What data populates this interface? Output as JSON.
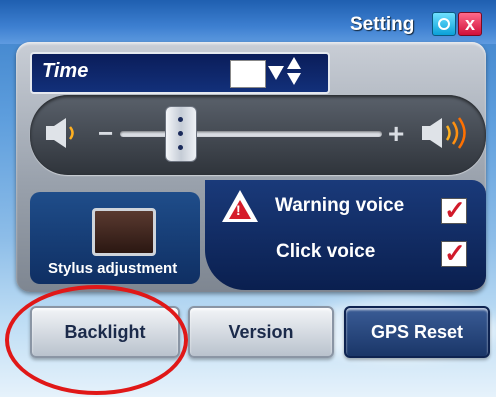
{
  "window": {
    "title": "Setting",
    "ok_icon": "ok-icon",
    "close_icon": "close-icon",
    "close_glyph": "x"
  },
  "time": {
    "label": "Time",
    "value": ""
  },
  "volume": {
    "minus_glyph": "−",
    "plus_glyph": "+",
    "level": 0.25
  },
  "stylus": {
    "label": "Stylus adjustment"
  },
  "voice": {
    "warning_label": "Warning voice",
    "warning_checked": true,
    "click_label": "Click voice",
    "click_checked": true,
    "check_glyph": "✓",
    "warning_glyph": "!"
  },
  "buttons": {
    "backlight": "Backlight",
    "version": "Version",
    "gps_reset": "GPS Reset"
  },
  "colors": {
    "accent_red": "#e01818",
    "checkbox_red": "#d11a2a",
    "panel_blue": "#0f2f63"
  }
}
